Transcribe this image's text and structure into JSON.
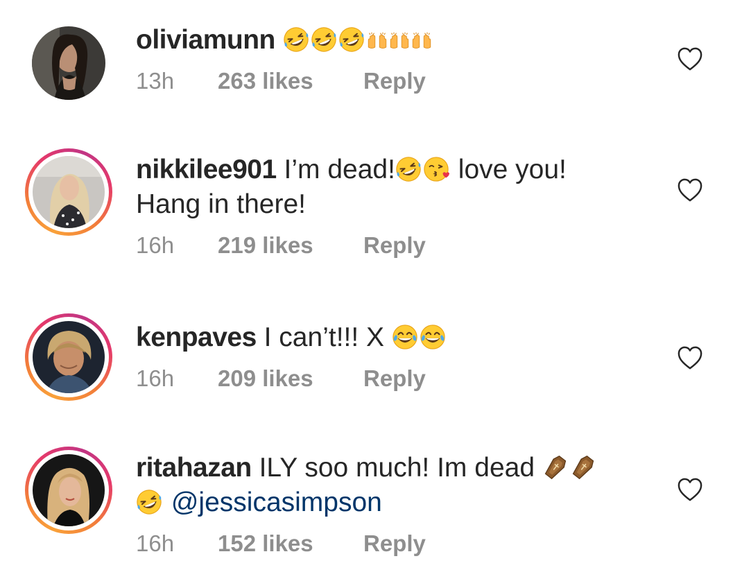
{
  "comments": [
    {
      "username": "oliviamunn",
      "text": "",
      "emojis": [
        "rolling-laughing-emoji",
        "rolling-laughing-emoji",
        "rolling-laughing-emoji",
        "raising-hands-emoji",
        "raising-hands-emoji",
        "raising-hands-emoji"
      ],
      "time": "13h",
      "likes": "263 likes",
      "reply": "Reply",
      "story_ring": false
    },
    {
      "username": "nikkilee901",
      "text_part1": "I’m dead!",
      "emojis": [
        "rolling-laughing-emoji",
        "kissing-heart-emoji"
      ],
      "text_part2": " love you!",
      "text_line2": "Hang in there!",
      "time": "16h",
      "likes": "219 likes",
      "reply": "Reply",
      "story_ring": true
    },
    {
      "username": "kenpaves",
      "text": "I can’t!!! X",
      "emojis": [
        "tears-of-joy-emoji",
        "tears-of-joy-emoji"
      ],
      "time": "16h",
      "likes": "209 likes",
      "reply": "Reply",
      "story_ring": true
    },
    {
      "username": "ritahazan",
      "text": "ILY soo much! Im dead",
      "emojis": [
        "coffin-emoji",
        "coffin-emoji",
        "rolling-laughing-emoji"
      ],
      "mention": "@jessicasimpson",
      "time": "16h",
      "likes": "152 likes",
      "reply": "Reply",
      "story_ring": true
    }
  ],
  "icons": {
    "like": "heart-outline-icon"
  },
  "colors": {
    "text": "#262626",
    "meta": "#8e8e8e",
    "mention": "#003569",
    "story_ring_start": "#f9a13a",
    "story_ring_end": "#c13584"
  }
}
